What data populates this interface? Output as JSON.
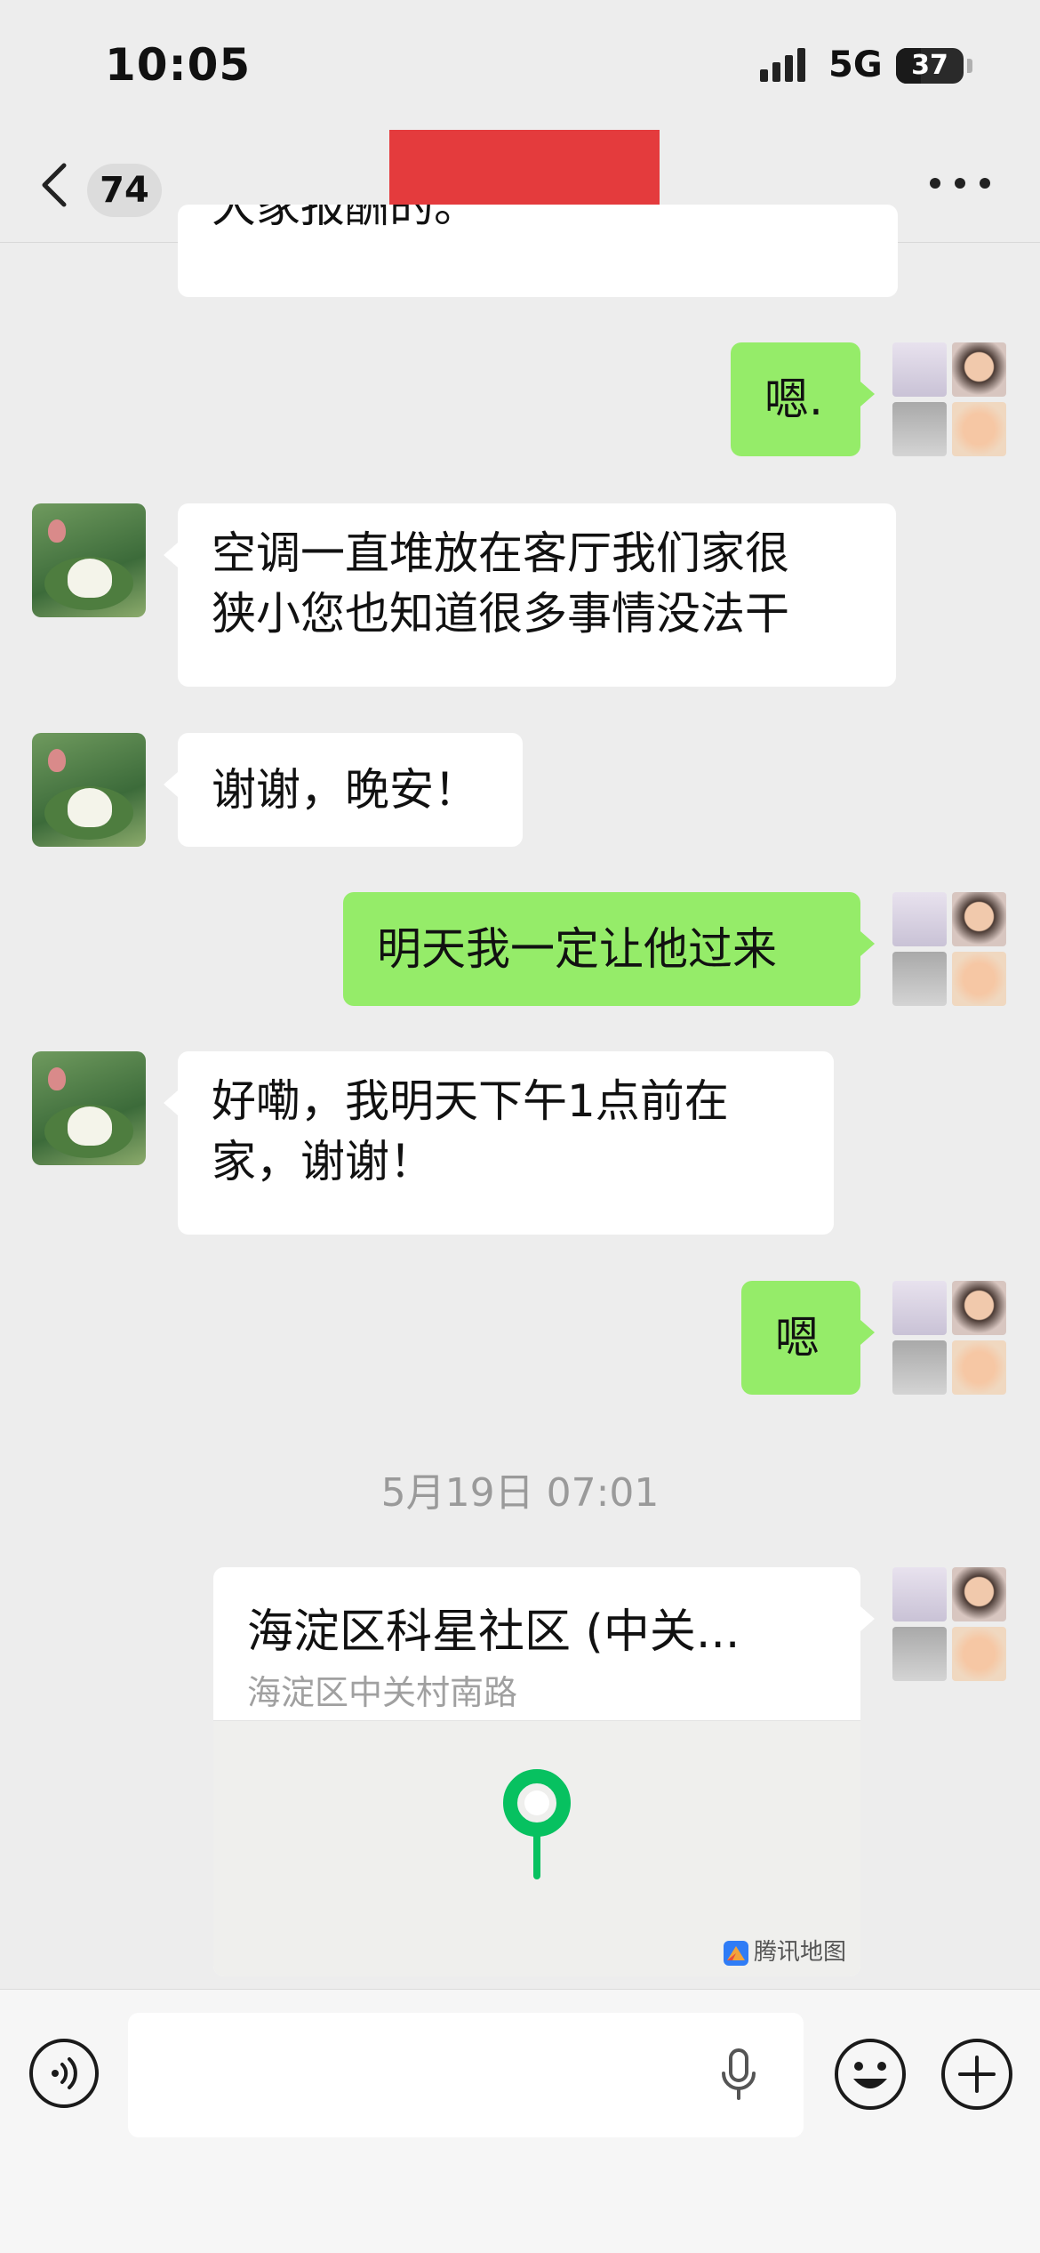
{
  "status_bar": {
    "time": "10:05",
    "network": "5G",
    "battery": "37"
  },
  "nav": {
    "unread_count": "74",
    "title": ""
  },
  "messages": [
    {
      "side": "left",
      "text": "大家报酬的。"
    },
    {
      "side": "right",
      "text": "嗯."
    },
    {
      "side": "left",
      "lines": [
        "空调一直堆放在客厅我们家很",
        "狭小您也知道很多事情没法干"
      ]
    },
    {
      "side": "left",
      "text": "谢谢，晚安！"
    },
    {
      "side": "right",
      "text": "明天我一定让他过来"
    },
    {
      "side": "left",
      "lines": [
        "好嘞，我明天下午1点前在",
        "家，谢谢！"
      ]
    },
    {
      "side": "right",
      "text": "嗯"
    }
  ],
  "timestamp": "5月19日 07:01",
  "location": {
    "title": "海淀区科星社区 (中关...",
    "address": "海淀区中关村南路",
    "map_brand": "腾讯地图"
  },
  "colors": {
    "own_bubble": "#95ec69",
    "other_bubble": "#ffffff",
    "background": "#ededed",
    "redaction": "#e43b3d",
    "pin": "#07c160"
  }
}
